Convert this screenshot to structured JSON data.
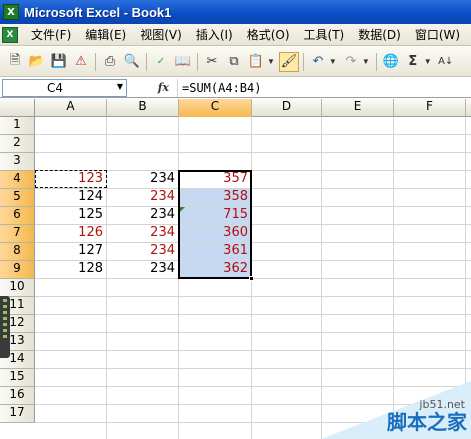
{
  "window": {
    "title": "Microsoft Excel - Book1",
    "app_icon": "excel-icon"
  },
  "menu": {
    "items": [
      "文件(F)",
      "编辑(E)",
      "视图(V)",
      "插入(I)",
      "格式(O)",
      "工具(T)",
      "数据(D)",
      "窗口(W)"
    ]
  },
  "toolbar": {
    "icons": [
      "new-icon",
      "open-icon",
      "save-icon",
      "permission-icon",
      "print-icon",
      "print-preview-icon",
      "spelling-icon",
      "research-icon",
      "cut-icon",
      "copy-icon",
      "paste-icon",
      "format-painter-icon",
      "undo-icon",
      "redo-icon",
      "hyperlink-icon",
      "autosum-icon",
      "sort-ascending-icon"
    ],
    "autosum_glyph": "Σ"
  },
  "formula_bar": {
    "name_box": "C4",
    "fx": "fx",
    "formula": "=SUM(A4:B4)"
  },
  "columns": [
    "A",
    "B",
    "C",
    "D",
    "E",
    "F"
  ],
  "selected_column": "C",
  "rows": [
    "1",
    "2",
    "3",
    "4",
    "5",
    "6",
    "7",
    "8",
    "9",
    "10",
    "11",
    "12",
    "13",
    "14",
    "15",
    "16",
    "17"
  ],
  "cells": {
    "A": [
      "123",
      "124",
      "125",
      "126",
      "127",
      "128"
    ],
    "B": [
      "234",
      "234",
      "234",
      "234",
      "234",
      "234"
    ],
    "C": [
      "357",
      "358",
      "715",
      "360",
      "361",
      "362"
    ]
  },
  "red_cells": {
    "A": [
      0,
      3
    ],
    "B": [
      1,
      3,
      4
    ],
    "C": [
      0,
      1,
      2,
      3,
      4,
      5
    ]
  },
  "colors": {
    "selection": "#c6d9f1",
    "red_text": "#b01010",
    "header_highlight": "#f4b84f",
    "titlebar": "#0a4cc4"
  },
  "watermark": {
    "url": "jb51.net",
    "name": "脚本之家"
  }
}
